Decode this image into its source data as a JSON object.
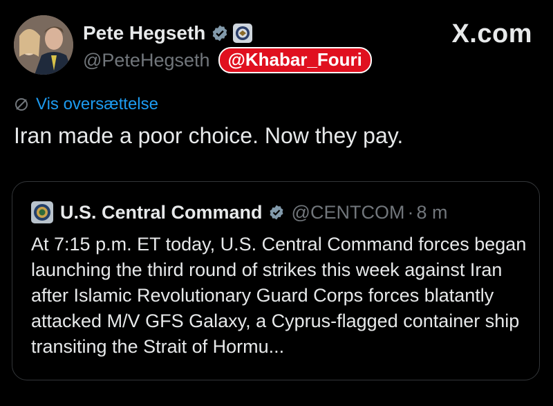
{
  "post": {
    "author_name": "Pete Hegseth",
    "author_handle": "@PeteHegseth",
    "watermark": "@Khabar_Fouri",
    "brand": "X.com",
    "translate_label": "Vis oversættelse",
    "text": "Iran made a poor choice. Now they pay."
  },
  "quote": {
    "author_name": "U.S. Central Command",
    "author_handle": "@CENTCOM",
    "separator": "·",
    "time": "8 m",
    "text": "At 7:15 p.m. ET today, U.S. Central Command forces began launching the third round of strikes this week against Iran after Islamic Revolutionary Guard Corps forces blatantly attacked M/V GFS Galaxy, a Cyprus-flagged container ship transiting the Strait of Hormu..."
  },
  "colors": {
    "background": "#000000",
    "link": "#1d9bf0",
    "secondary_text": "#71767b",
    "watermark_bg": "#e0101f"
  },
  "icons": [
    "verified-badge-icon",
    "government-seal-icon",
    "translate-icon",
    "centcom-logo-icon"
  ]
}
